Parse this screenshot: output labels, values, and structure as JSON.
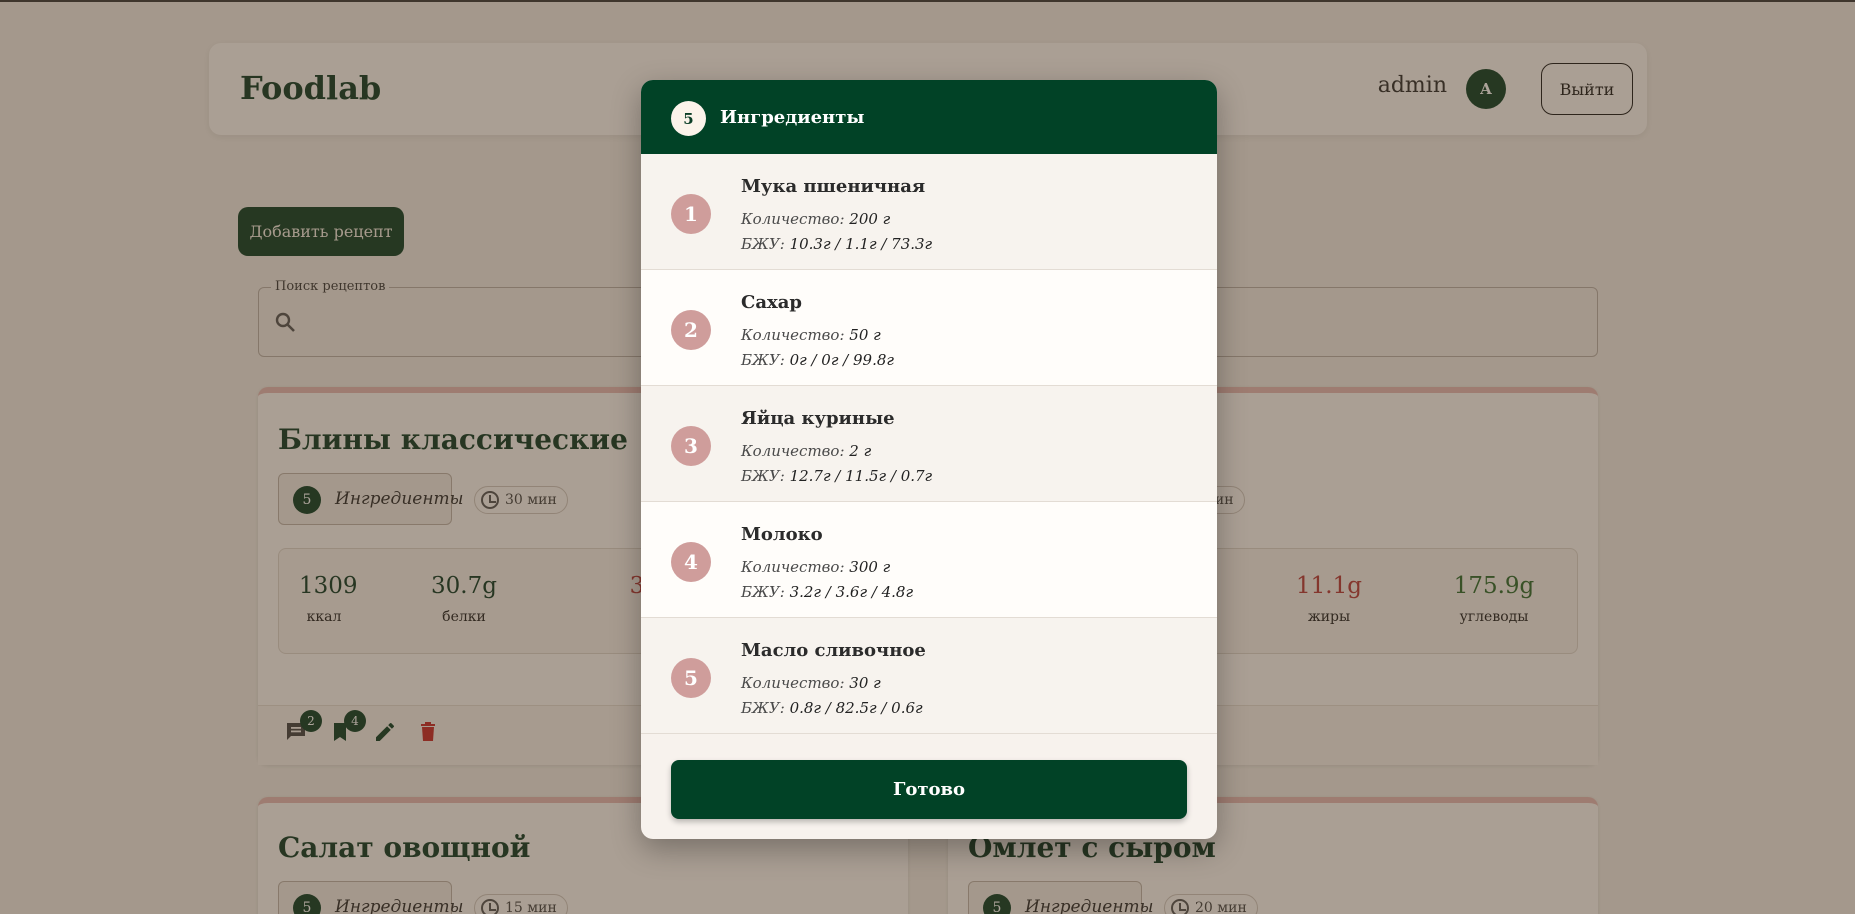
{
  "app": {
    "title": "Foodlab"
  },
  "header": {
    "user": "admin",
    "avatar_letter": "A",
    "logout_label": "Выйти"
  },
  "toolbar": {
    "add_recipe_label": "Добавить рецепт"
  },
  "search": {
    "label": "Поиск рецептов",
    "value": ""
  },
  "recipes": [
    {
      "title": "Блины классические",
      "ingredients_count": "5",
      "ingredients_label": "Ингредиенты",
      "time": "30 мин",
      "nutrition": [
        {
          "value": "1309",
          "unit": "ккал"
        },
        {
          "value": "30.7g",
          "unit": "белки"
        },
        {
          "value": "3",
          "unit": ""
        }
      ],
      "comments_count": "2",
      "bookmarks_count": "4"
    },
    {
      "title": "",
      "time_partial": "мин",
      "nutrition": [
        {
          "value": "11.1g",
          "unit": "жиры"
        },
        {
          "value": "175.9g",
          "unit": "углеводы"
        }
      ]
    },
    {
      "title": "Салат овощной",
      "ingredients_count": "5",
      "ingredients_label": "Ингредиенты",
      "time": "15 мин"
    },
    {
      "title": "Омлет с сыром",
      "ingredients_count": "5",
      "ingredients_label": "Ингредиенты",
      "time": "20 мин"
    }
  ],
  "modal": {
    "count": "5",
    "title": "Ингредиенты",
    "qty_prefix": "Количество:",
    "bju_prefix": "БЖУ:",
    "items": [
      {
        "num": "1",
        "name": "Мука пшеничная",
        "qty": "200 г",
        "bju": "10.3г / 1.1г / 73.3г"
      },
      {
        "num": "2",
        "name": "Сахар",
        "qty": "50 г",
        "bju": "0г / 0г / 99.8г"
      },
      {
        "num": "3",
        "name": "Яйца куриные",
        "qty": "2 г",
        "bju": "12.7г / 11.5г / 0.7г"
      },
      {
        "num": "4",
        "name": "Молоко",
        "qty": "300 г",
        "bju": "3.2г / 3.6г / 4.8г"
      },
      {
        "num": "5",
        "name": "Масло сливочное",
        "qty": "30 г",
        "bju": "0.8г / 82.5г / 0.6г"
      }
    ],
    "done_label": "Готово"
  }
}
